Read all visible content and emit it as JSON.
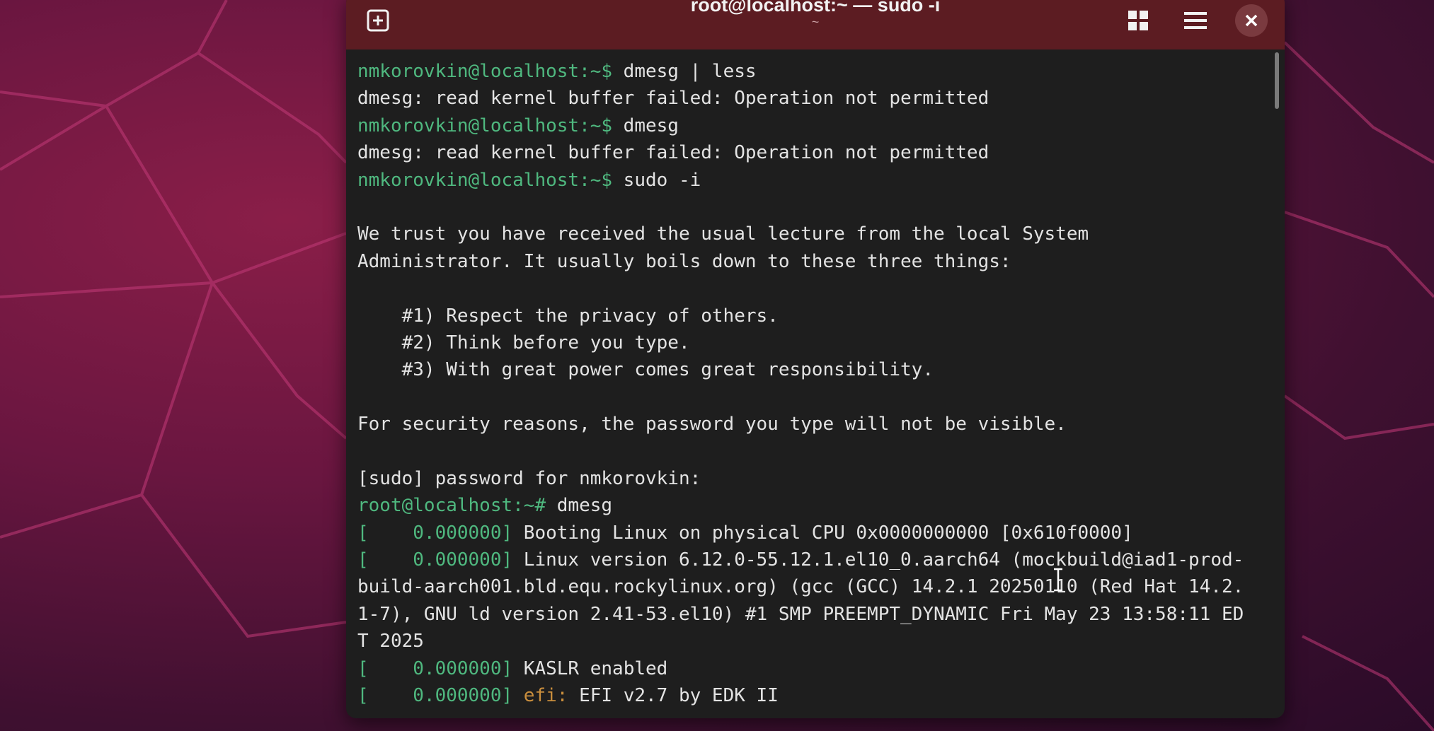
{
  "window": {
    "title": "root@localhost:~ — sudo -i",
    "subtitle": "~"
  },
  "icons": {
    "new_tab": "new-tab-icon",
    "grid": "grid-icon",
    "menu": "hamburger-menu-icon",
    "close": "close-icon"
  },
  "colors": {
    "titlebar": "#5c1c22",
    "terminal_bg": "#1e1e1e",
    "prompt_green": "#4fb87f",
    "efi_orange": "#c98e3d",
    "text": "#e3e3e3"
  },
  "terminal": {
    "lines": [
      {
        "prompt": "nmkorovkin@localhost:~$",
        "cmd": " dmesg | less"
      },
      {
        "text": "dmesg: read kernel buffer failed: Operation not permitted"
      },
      {
        "prompt": "nmkorovkin@localhost:~$",
        "cmd": " dmesg"
      },
      {
        "text": "dmesg: read kernel buffer failed: Operation not permitted"
      },
      {
        "prompt": "nmkorovkin@localhost:~$",
        "cmd": " sudo -i"
      },
      {
        "text": ""
      },
      {
        "text": "We trust you have received the usual lecture from the local System"
      },
      {
        "text": "Administrator. It usually boils down to these three things:"
      },
      {
        "text": ""
      },
      {
        "text": "    #1) Respect the privacy of others."
      },
      {
        "text": "    #2) Think before you type."
      },
      {
        "text": "    #3) With great power comes great responsibility."
      },
      {
        "text": ""
      },
      {
        "text": "For security reasons, the password you type will not be visible."
      },
      {
        "text": ""
      },
      {
        "text": "[sudo] password for nmkorovkin:"
      },
      {
        "prompt": "root@localhost:~#",
        "cmd": " dmesg"
      },
      {
        "bracket": "[    0.000000]",
        "text": " Booting Linux on physical CPU 0x0000000000 [0x610f0000]"
      },
      {
        "bracket": "[    0.000000]",
        "text": " Linux version 6.12.0-55.12.1.el10_0.aarch64 (mockbuild@iad1-prod-"
      },
      {
        "text": "build-aarch001.bld.equ.rockylinux.org) (gcc (GCC) 14.2.1 20250110 (Red Hat 14.2."
      },
      {
        "text": "1-7), GNU ld version 2.41-53.el10) #1 SMP PREEMPT_DYNAMIC Fri May 23 13:58:11 ED"
      },
      {
        "text": "T 2025"
      },
      {
        "bracket": "[    0.000000]",
        "text": " KASLR enabled"
      },
      {
        "bracket": "[    0.000000]",
        "efi": " efi:",
        "text": " EFI v2.7 by EDK II"
      }
    ]
  }
}
